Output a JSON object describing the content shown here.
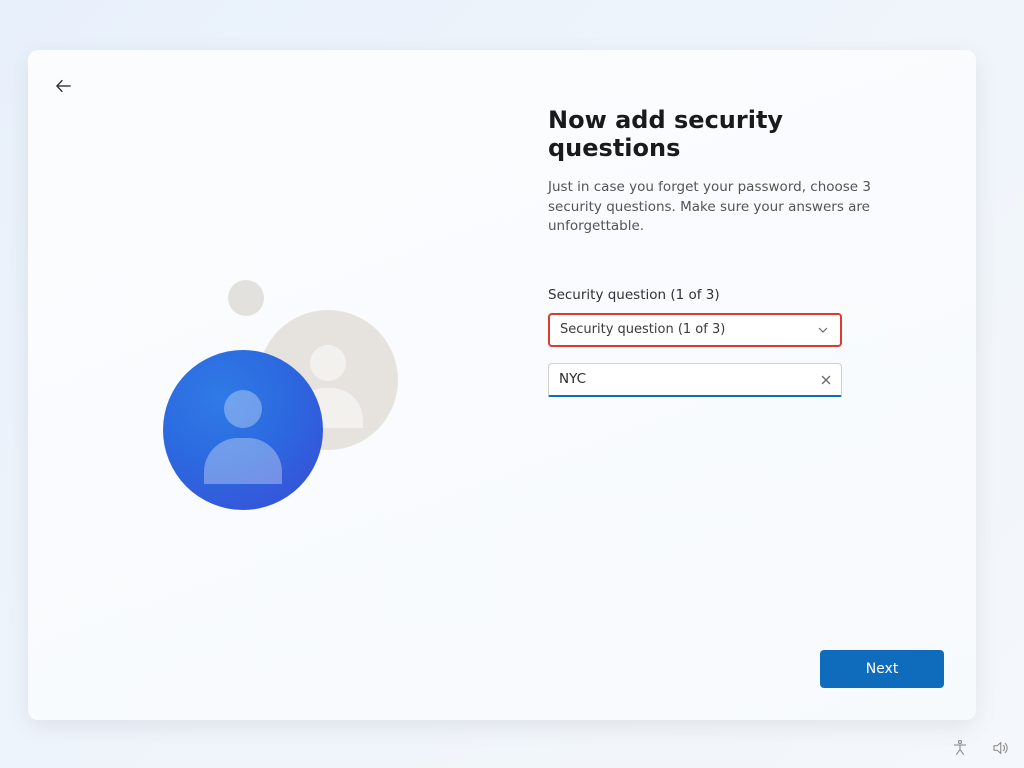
{
  "header": {
    "title": "Now add security questions",
    "subtitle": "Just in case you forget your password, choose 3 security questions. Make sure your answers are unforgettable."
  },
  "form": {
    "question_label": "Security question (1 of 3)",
    "dropdown_selected": "Security question (1 of 3)",
    "answer_value": "NYC"
  },
  "footer": {
    "next_label": "Next"
  },
  "icons": {
    "back": "back-arrow",
    "chevron": "chevron-down",
    "clear": "close",
    "accessibility": "accessibility",
    "volume": "volume"
  },
  "highlight": {
    "dropdown_border_color": "#d93a32"
  }
}
